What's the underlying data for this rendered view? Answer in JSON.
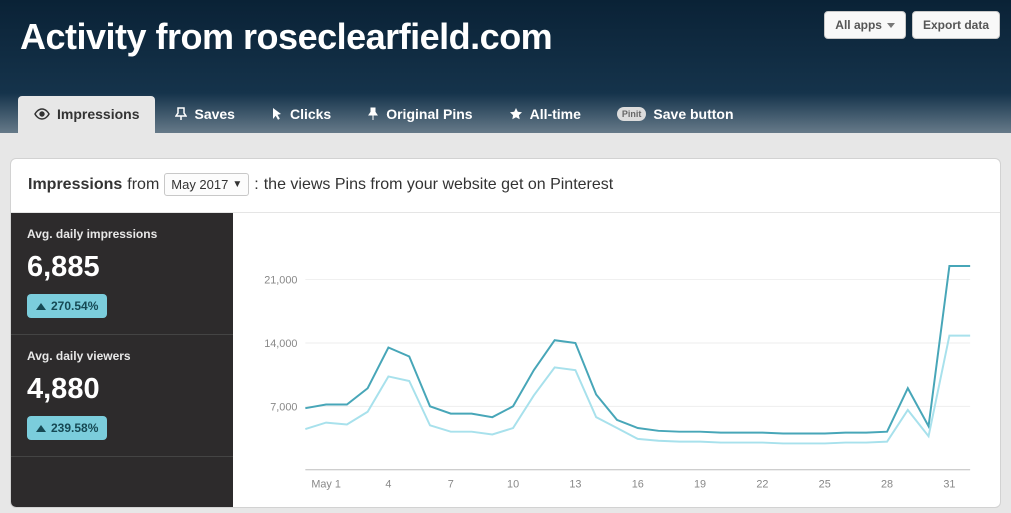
{
  "header": {
    "title": "Activity from roseclearfield.com",
    "all_apps_label": "All apps",
    "export_label": "Export data"
  },
  "tabs": {
    "impressions": "Impressions",
    "saves": "Saves",
    "clicks": "Clicks",
    "original_pins": "Original Pins",
    "all_time": "All-time",
    "save_button_badge": "Pinit",
    "save_button": "Save button"
  },
  "panel": {
    "metric_name": "Impressions",
    "from_word": "from",
    "period": "May 2017",
    "colon": ":",
    "description": "the views Pins from your website get on Pinterest"
  },
  "metrics": {
    "impressions": {
      "label": "Avg. daily impressions",
      "value": "6,885",
      "delta": "270.54%"
    },
    "viewers": {
      "label": "Avg. daily viewers",
      "value": "4,880",
      "delta": "239.58%"
    }
  },
  "chart_data": {
    "type": "line",
    "title": "Impressions from May 2017",
    "xlabel": "",
    "ylabel": "",
    "ylim": [
      0,
      24000
    ],
    "yticks": [
      7000,
      14000,
      21000
    ],
    "ytick_labels": [
      "7,000",
      "14,000",
      "21,000"
    ],
    "x": [
      0,
      1,
      2,
      3,
      4,
      5,
      6,
      7,
      8,
      9,
      10,
      11,
      12,
      13,
      14,
      15,
      16,
      17,
      18,
      19,
      20,
      21,
      22,
      23,
      24,
      25,
      26,
      27,
      28,
      29,
      30,
      31,
      32
    ],
    "xtick_labels": [
      "May 1",
      "4",
      "7",
      "10",
      "13",
      "16",
      "19",
      "22",
      "25",
      "28",
      "31"
    ],
    "xtick_positions": [
      1,
      4,
      7,
      10,
      13,
      16,
      19,
      22,
      25,
      28,
      31
    ],
    "series": [
      {
        "name": "Avg. daily impressions",
        "color": "#47a6b8",
        "values": [
          6800,
          7200,
          7200,
          9000,
          13500,
          12500,
          7000,
          6200,
          6200,
          5800,
          7000,
          11000,
          14300,
          14000,
          8300,
          5500,
          4600,
          4300,
          4200,
          4200,
          4100,
          4100,
          4100,
          4000,
          4000,
          4000,
          4100,
          4100,
          4200,
          9000,
          4800,
          22500,
          22500
        ]
      },
      {
        "name": "Avg. daily viewers",
        "color": "#a8e1ec",
        "values": [
          4500,
          5200,
          5000,
          6400,
          10300,
          9800,
          4900,
          4200,
          4200,
          3900,
          4600,
          8200,
          11300,
          11000,
          5800,
          4600,
          3400,
          3200,
          3100,
          3100,
          3000,
          3000,
          3000,
          2900,
          2900,
          2900,
          3000,
          3000,
          3100,
          6600,
          3700,
          14800,
          14800
        ]
      }
    ]
  }
}
